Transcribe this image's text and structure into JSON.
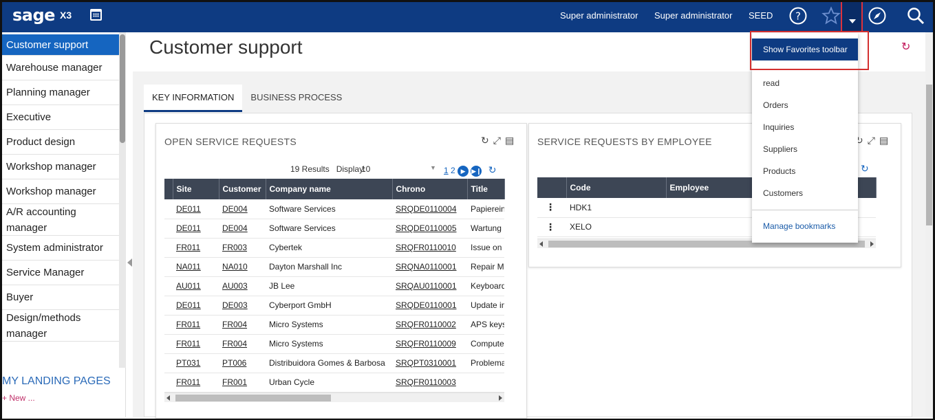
{
  "topbar": {
    "logo": "sage",
    "product": "X3",
    "user_name": "Super administrator",
    "user_role": "Super administrator",
    "folder": "SEED"
  },
  "sidebar": {
    "items": [
      "Customer support",
      "Warehouse manager",
      "Planning manager",
      "Executive",
      "Product design",
      "Workshop manager",
      "Workshop manager",
      "A/R accounting manager",
      "System administrator",
      "Service Manager",
      "Buyer",
      "Design/methods manager"
    ],
    "landing_title": "MY LANDING PAGES",
    "new_label": "+ New ..."
  },
  "page": {
    "title": "Customer support",
    "tabs": [
      "KEY INFORMATION",
      "BUSINESS PROCESS"
    ]
  },
  "open_requests": {
    "title": "OPEN SERVICE REQUESTS",
    "results": "19 Results",
    "display_label": "Display:",
    "display_value": "10",
    "page_1": "1",
    "page_2": "2",
    "columns": [
      "Site",
      "Customer",
      "Company name",
      "Chrono",
      "Title"
    ],
    "rows": [
      [
        "DE011",
        "DE004",
        "Software Services",
        "SRQDE0110004",
        "Papierein"
      ],
      [
        "DE011",
        "DE004",
        "Software Services",
        "SRQDE0110005",
        "Wartung"
      ],
      [
        "FR011",
        "FR003",
        "Cybertek",
        "SRQFR0110010",
        "Issue on c"
      ],
      [
        "NA011",
        "NA010",
        "Dayton Marshall Inc",
        "SRQNA0110001",
        "Repair Mo"
      ],
      [
        "AU011",
        "AU003",
        "JB Lee",
        "SRQAU0110001",
        "Keyboard"
      ],
      [
        "DE011",
        "DE003",
        "Cyberport GmbH",
        "SRQDE0110001",
        "Update in"
      ],
      [
        "FR011",
        "FR004",
        "Micro Systems",
        "SRQFR0110002",
        "APS keys"
      ],
      [
        "FR011",
        "FR004",
        "Micro Systems",
        "SRQFR0110009",
        "Compute"
      ],
      [
        "PT031",
        "PT006",
        "Distribuidora Gomes & Barbosa",
        "SRQPT0310001",
        "Problema"
      ],
      [
        "FR011",
        "FR001",
        "Urban Cycle",
        "SRQFR0110003",
        ""
      ]
    ]
  },
  "by_employee": {
    "title": "SERVICE REQUESTS BY EMPLOYEE",
    "columns": [
      "Code",
      "Employee"
    ],
    "rows": [
      [
        "HDK1",
        ""
      ],
      [
        "XELO",
        ""
      ]
    ]
  },
  "favorites_menu": {
    "primary": "Show Favorites toolbar",
    "items": [
      "read",
      "Orders",
      "Inquiries",
      "Suppliers",
      "Products",
      "Customers"
    ],
    "footer": "Manage bookmarks"
  },
  "colors": {
    "topbar": "#0e3b82",
    "active_sidebar": "#1565c0",
    "grid_header": "#3d4655",
    "highlight_box": "#d32f2f"
  },
  "icons": [
    "calendar-icon",
    "help-icon",
    "star-icon",
    "compass-icon",
    "search-icon",
    "refresh-icon",
    "expand-icon",
    "card-settings-icon"
  ]
}
